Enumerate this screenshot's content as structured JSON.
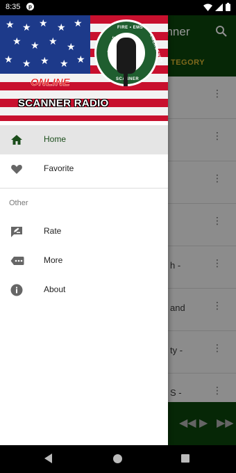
{
  "status_bar": {
    "time": "8:35",
    "data_icon": "p"
  },
  "app": {
    "title": "anner",
    "tab": "TEGORY",
    "rows": [
      {
        "text": ""
      },
      {
        "text": ""
      },
      {
        "text": ""
      },
      {
        "text": ""
      },
      {
        "text": "h -"
      },
      {
        "text": "and"
      },
      {
        "text": "ty -"
      },
      {
        "text": "S -"
      }
    ]
  },
  "drawer": {
    "header": {
      "online": "ONLINE",
      "scanner_radio": "SCANNER RADIO"
    },
    "items": [
      {
        "label": "Home",
        "icon": "home-icon"
      },
      {
        "label": "Favorite",
        "icon": "heart-icon"
      }
    ],
    "section_label": "Other",
    "other_items": [
      {
        "label": "Rate",
        "icon": "rate-icon"
      },
      {
        "label": "More",
        "icon": "more-icon"
      },
      {
        "label": "About",
        "icon": "info-icon"
      }
    ]
  },
  "colors": {
    "toolbar": "#0a3d0a",
    "accent": "#c4a12c",
    "active_item_bg": "#e5e5e5"
  }
}
